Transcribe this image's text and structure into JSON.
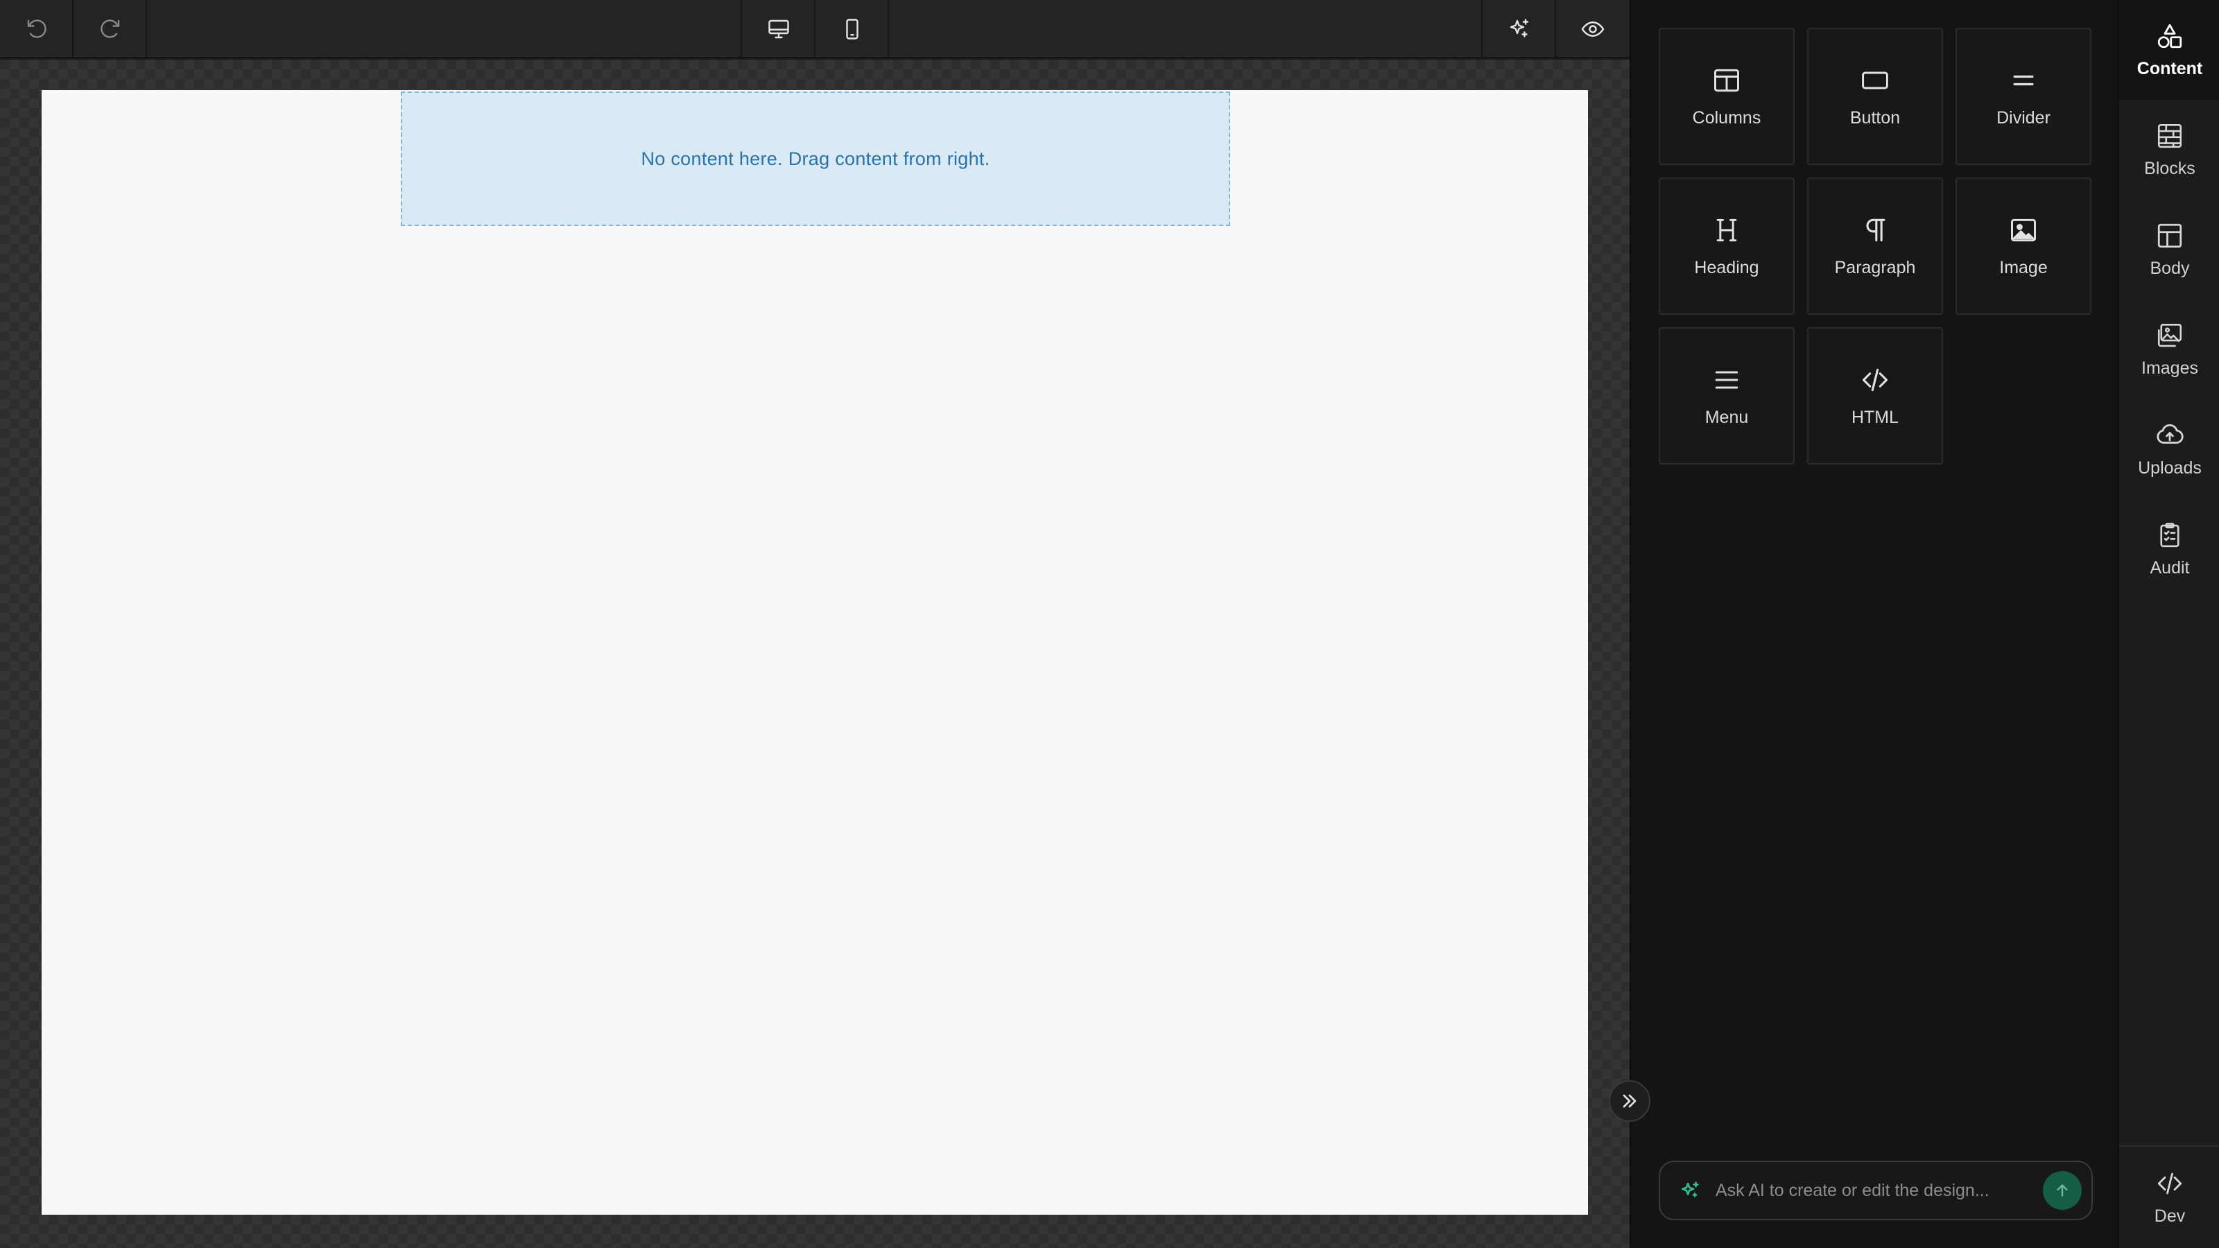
{
  "canvas": {
    "dropzone_text": "No content here. Drag content from right."
  },
  "tools": [
    {
      "label": "Columns",
      "icon": "columns-icon"
    },
    {
      "label": "Button",
      "icon": "button-icon"
    },
    {
      "label": "Divider",
      "icon": "divider-icon"
    },
    {
      "label": "Heading",
      "icon": "heading-icon"
    },
    {
      "label": "Paragraph",
      "icon": "paragraph-icon"
    },
    {
      "label": "Image",
      "icon": "image-icon"
    },
    {
      "label": "Menu",
      "icon": "menu-icon"
    },
    {
      "label": "HTML",
      "icon": "code-icon"
    }
  ],
  "ai": {
    "placeholder": "Ask AI to create or edit the design..."
  },
  "nav": [
    {
      "label": "Content",
      "icon": "shapes-icon",
      "active": true
    },
    {
      "label": "Blocks",
      "icon": "blocks-icon"
    },
    {
      "label": "Body",
      "icon": "layout-icon"
    },
    {
      "label": "Images",
      "icon": "images-icon"
    },
    {
      "label": "Uploads",
      "icon": "cloud-upload-icon"
    },
    {
      "label": "Audit",
      "icon": "clipboard-check-icon"
    },
    {
      "label": "Dev",
      "icon": "code-icon"
    }
  ],
  "colors": {
    "accent_green": "#155e45",
    "dropzone_bg": "#d9eaf4",
    "dropzone_text": "#2a72a8"
  }
}
